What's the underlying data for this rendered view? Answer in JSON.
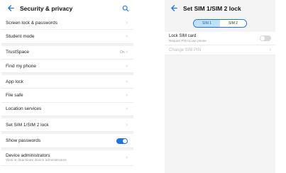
{
  "left": {
    "title": "Security & privacy",
    "rows": [
      {
        "label": "Screen lock & passwords"
      },
      {
        "label": "Student mode"
      },
      {
        "label": "TrustSpace",
        "value": "On"
      },
      {
        "label": "Find my phone"
      },
      {
        "label": "App lock"
      },
      {
        "label": "File safe"
      },
      {
        "label": "Location services"
      },
      {
        "label": "Set SIM 1/SIM 2 lock"
      },
      {
        "label": "Show passwords",
        "toggle": "on"
      },
      {
        "label": "Device administrators",
        "sublabel": "View or deactivate device administrators"
      }
    ]
  },
  "right": {
    "title": "Set SIM 1/SIM 2 lock",
    "tabs": [
      "SIM 1",
      "SIM 2"
    ],
    "active_tab": "SIM 1",
    "lock_sim": {
      "label": "Lock SIM card",
      "sublabel": "Require PIN to use phone",
      "toggle": "off"
    },
    "change_pin": {
      "label": "Change SIM PIN"
    }
  },
  "colors": {
    "accent": "#1a73e8",
    "tab_active_bg": "#bfe1ff"
  },
  "icons": {
    "back": "arrow-left-icon",
    "search": "search-icon",
    "chevron": "chevron-right-icon"
  }
}
